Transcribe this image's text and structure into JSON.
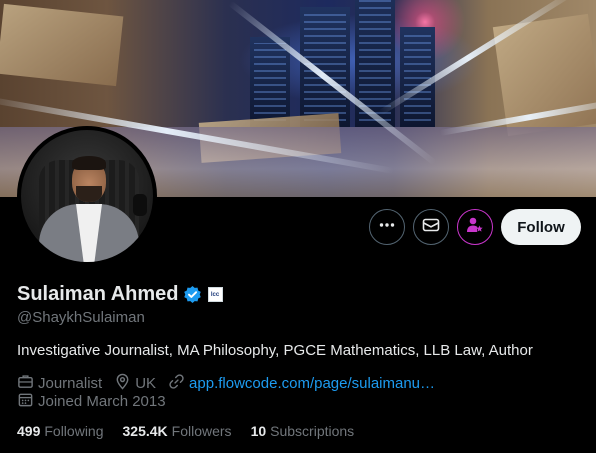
{
  "profile": {
    "display_name": "Sulaiman Ahmed",
    "handle": "@ShaykhSulaiman",
    "bio": "Investigative Journalist, MA Philosophy, PGCE Mathematics, LLB Law, Author",
    "affiliation_badge_text": "lcc",
    "verified": true
  },
  "actions": {
    "follow_label": "Follow",
    "more_icon": "more-icon",
    "message_icon": "envelope-icon",
    "subscribe_icon": "person-star-icon"
  },
  "meta": {
    "category": "Journalist",
    "location": "UK",
    "website": "app.flowcode.com/page/sulaimanu…",
    "joined": "Joined March 2013"
  },
  "stats": {
    "following_count": "499",
    "following_label": "Following",
    "followers_count": "325.4K",
    "followers_label": "Followers",
    "subscriptions_count": "10",
    "subscriptions_label": "Subscriptions"
  },
  "colors": {
    "accent_blue": "#1d9bf0",
    "subscribe_purple": "#c936cc",
    "muted_text": "#71767b",
    "primary_text": "#e7e9ea",
    "background": "#000000"
  }
}
